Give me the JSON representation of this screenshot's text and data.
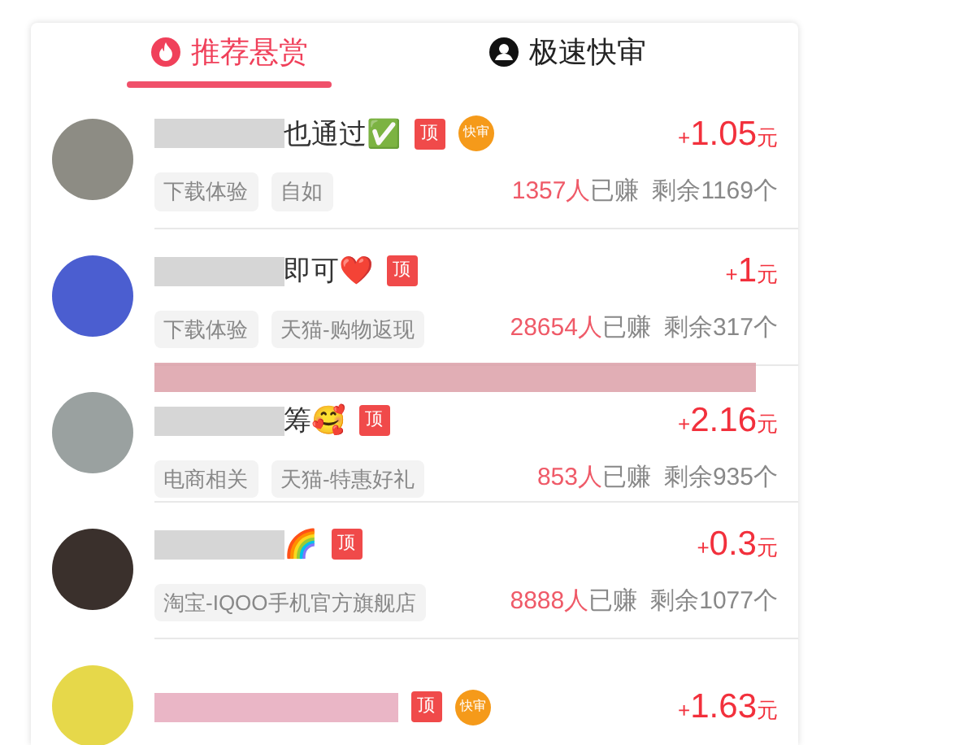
{
  "tabs": [
    {
      "label": "推荐悬赏",
      "selected": true
    },
    {
      "label": "极速快审",
      "selected": false
    }
  ],
  "tasks": [
    {
      "redacted_above": false,
      "title": "也通过✅",
      "badges": [
        {
          "kind": "top",
          "label": "顶"
        },
        {
          "kind": "fast",
          "label": "快审"
        }
      ],
      "tags": [
        "下载体验",
        "自如"
      ],
      "sign": "+",
      "amount": "1.05",
      "unit": "元",
      "earned_count": "1357人",
      "earned_label": "已赚",
      "remaining": "剩余1169个"
    },
    {
      "redacted_above": false,
      "title": "即可❤️",
      "badges": [
        {
          "kind": "top",
          "label": "顶"
        }
      ],
      "tags": [
        "下载体验",
        "天猫-购物返现"
      ],
      "sign": "+",
      "amount": "1",
      "unit": "元",
      "earned_count": "28654人",
      "earned_label": "已赚",
      "remaining": "剩余317个"
    },
    {
      "redacted_above": true,
      "title": "筹🥰",
      "badges": [
        {
          "kind": "top",
          "label": "顶"
        }
      ],
      "tags": [
        "电商相关",
        "天猫-特惠好礼"
      ],
      "sign": "+",
      "amount": "2.16",
      "unit": "元",
      "earned_count": "853人",
      "earned_label": "已赚",
      "remaining": "剩余935个"
    },
    {
      "redacted_above": false,
      "title": "🌈",
      "badges": [
        {
          "kind": "top",
          "label": "顶"
        }
      ],
      "tags": [
        "淘宝-IQOO手机官方旗舰店"
      ],
      "sign": "+",
      "amount": "0.3",
      "unit": "元",
      "earned_count": "8888人",
      "earned_label": "已赚",
      "remaining": "剩余1077个"
    },
    {
      "redacted_above": false,
      "badges": [
        {
          "kind": "top",
          "label": "顶"
        },
        {
          "kind": "fast",
          "label": "快审"
        }
      ],
      "sign": "+",
      "amount": "1.63",
      "unit": "元"
    }
  ]
}
